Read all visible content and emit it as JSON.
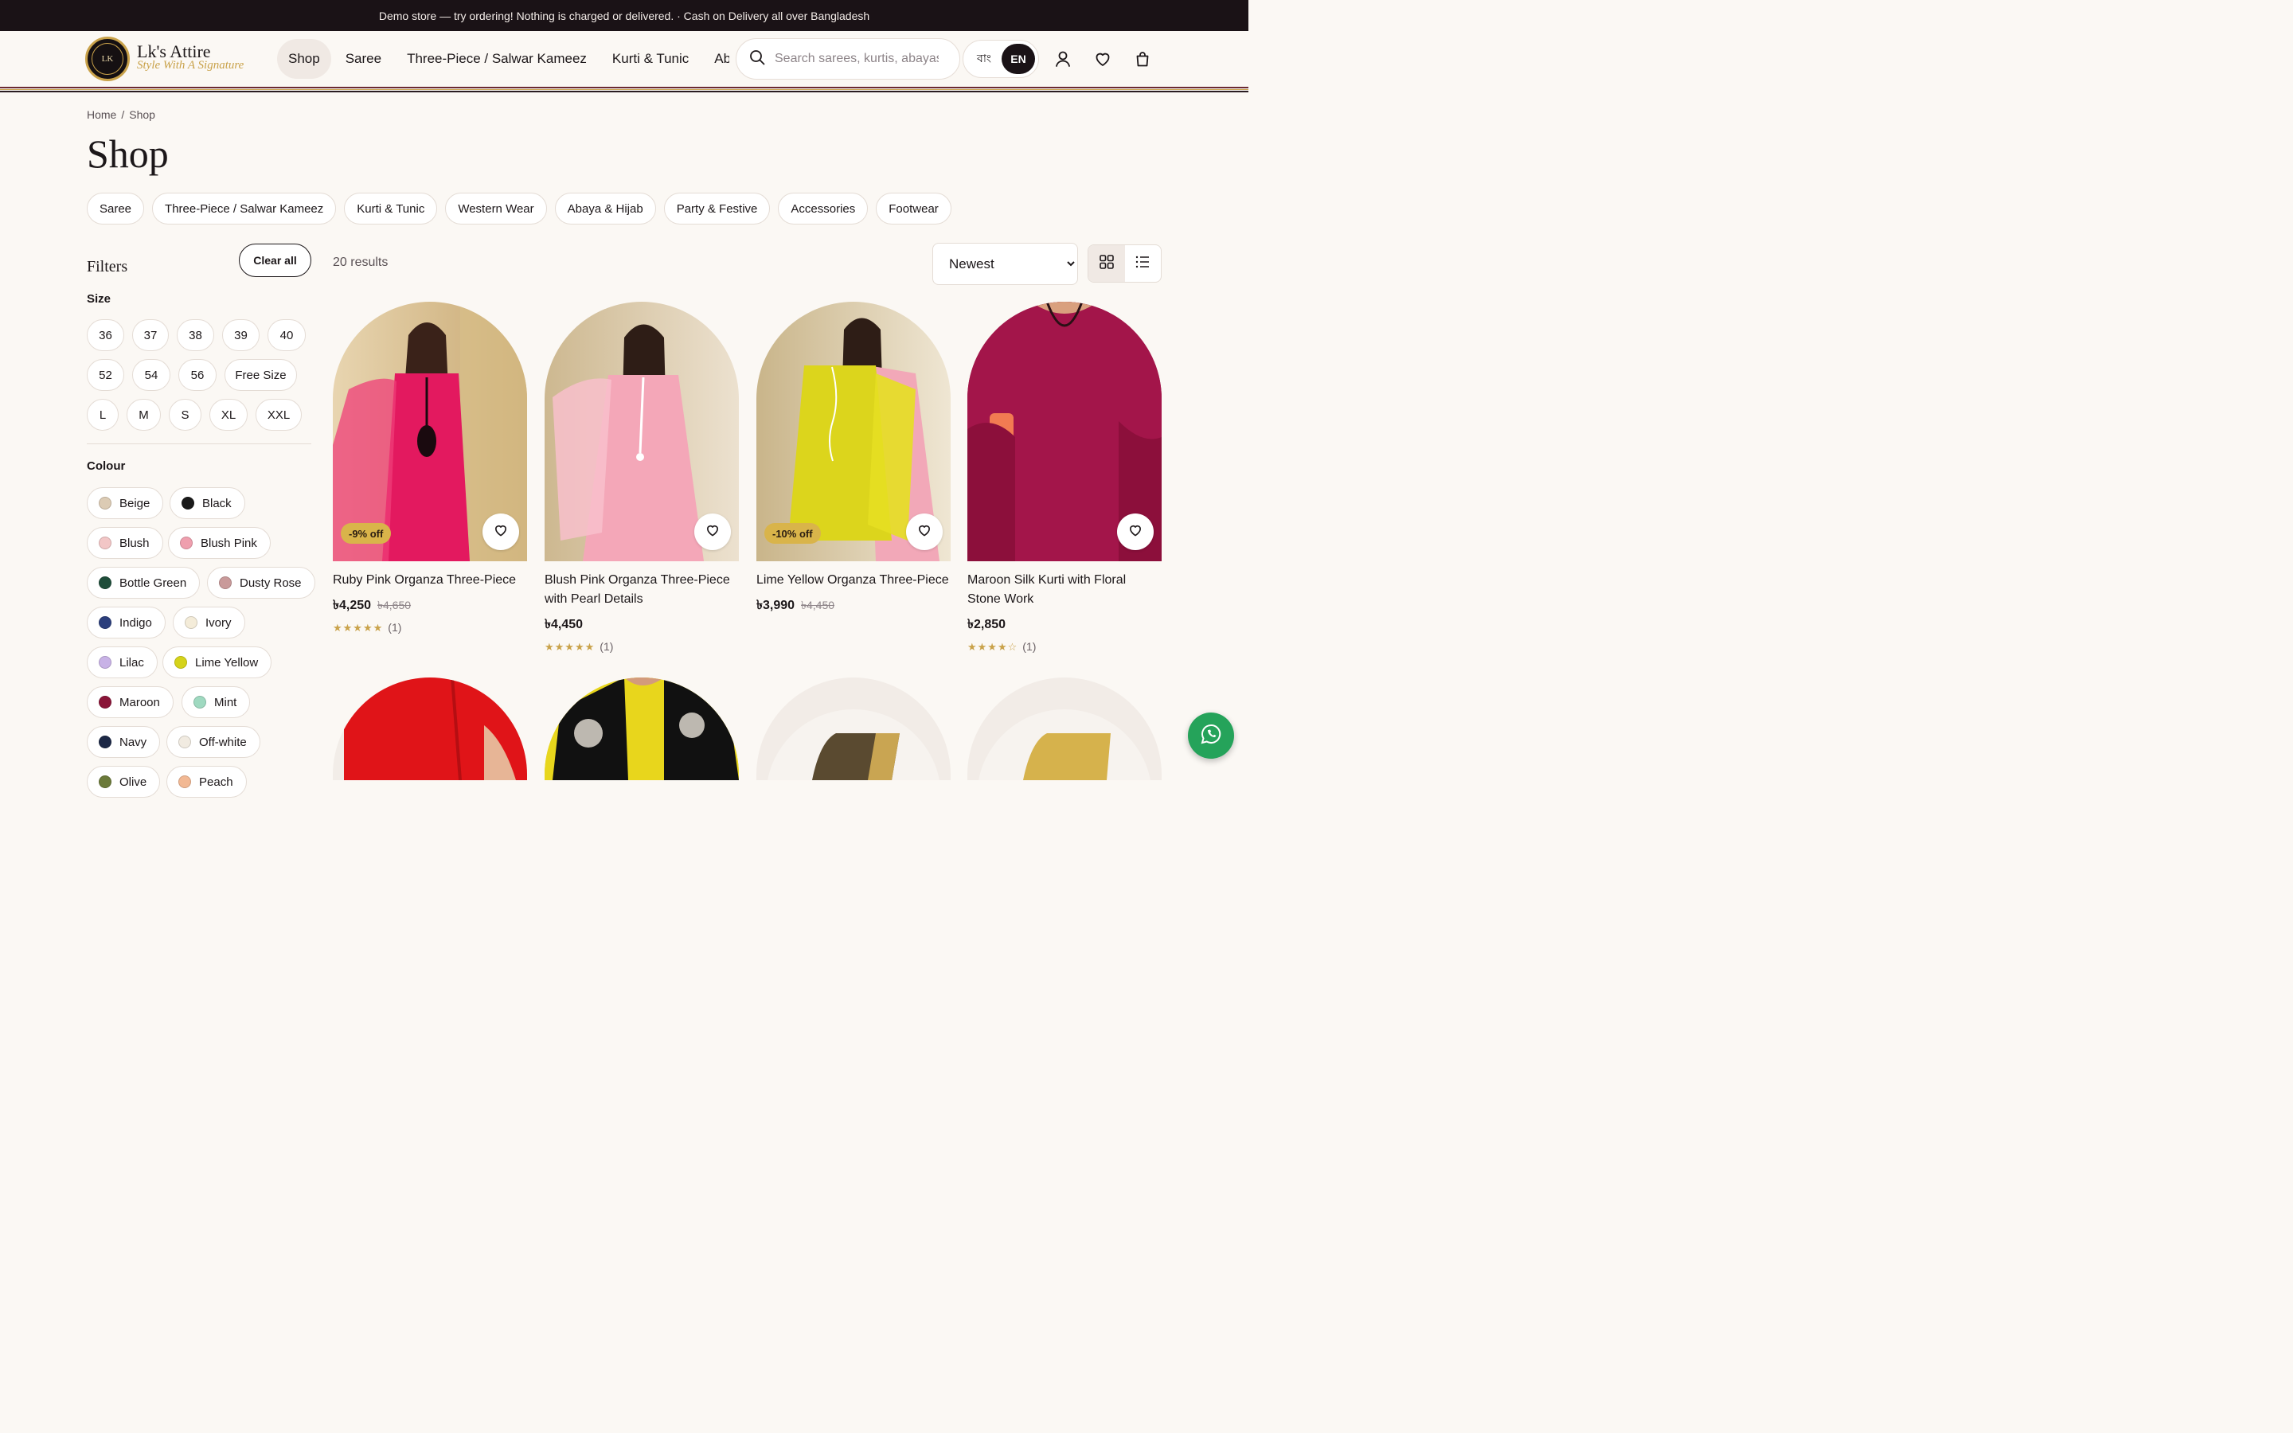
{
  "announcement": "Demo store — try ordering! Nothing is charged or delivered. · Cash on Delivery all over Bangladesh",
  "brand": {
    "name": "Lk's Attire",
    "tagline": "Style With A Signature",
    "logo_text": "LK"
  },
  "nav": [
    {
      "label": "Shop",
      "active": true
    },
    {
      "label": "Saree"
    },
    {
      "label": "Three-Piece / Salwar Kameez"
    },
    {
      "label": "Kurti & Tunic"
    },
    {
      "label": "Abou"
    }
  ],
  "search": {
    "placeholder": "Search sarees, kurtis, abayas…"
  },
  "lang": {
    "bn": "বাং",
    "en": "EN"
  },
  "breadcrumb": [
    "Home",
    "/",
    "Shop"
  ],
  "page_title": "Shop",
  "categories": [
    "Saree",
    "Three-Piece / Salwar Kameez",
    "Kurti & Tunic",
    "Western Wear",
    "Abaya & Hijab",
    "Party & Festive",
    "Accessories",
    "Footwear"
  ],
  "filters": {
    "title": "Filters",
    "clear_all": "Clear all",
    "size_title": "Size",
    "sizes": [
      "36",
      "37",
      "38",
      "39",
      "40",
      "52",
      "54",
      "56",
      "Free Size",
      "L",
      "M",
      "S",
      "XL",
      "XXL"
    ],
    "colour_title": "Colour",
    "colours": [
      {
        "name": "Beige",
        "hex": "#dccbb4"
      },
      {
        "name": "Black",
        "hex": "#1a1a1a"
      },
      {
        "name": "Blush",
        "hex": "#f2c6c6"
      },
      {
        "name": "Blush Pink",
        "hex": "#ef9fae"
      },
      {
        "name": "Bottle Green",
        "hex": "#1f4d3a"
      },
      {
        "name": "Dusty Rose",
        "hex": "#c99a9a"
      },
      {
        "name": "Indigo",
        "hex": "#2c3f7c"
      },
      {
        "name": "Ivory",
        "hex": "#f4ecd9"
      },
      {
        "name": "Lilac",
        "hex": "#c8b2e6"
      },
      {
        "name": "Lime Yellow",
        "hex": "#d5d31a"
      },
      {
        "name": "Maroon",
        "hex": "#8a1538"
      },
      {
        "name": "Mint",
        "hex": "#9fd9c0"
      },
      {
        "name": "Navy",
        "hex": "#1c2846"
      },
      {
        "name": "Off-white",
        "hex": "#f1ebe1"
      },
      {
        "name": "Olive",
        "hex": "#6b7a3a"
      },
      {
        "name": "Peach",
        "hex": "#f2b893"
      }
    ]
  },
  "results_count": "20 results",
  "sort": {
    "selected": "Newest"
  },
  "products": [
    {
      "name": "Ruby Pink Organza Three-Piece",
      "price": "৳4,250",
      "old_price": "৳4,650",
      "badge": "-9% off",
      "stars": "★★★★★",
      "rating": 5,
      "reviews": "(1)",
      "color": "#e01b63"
    },
    {
      "name": "Blush Pink Organza Three-Piece with Pearl Details",
      "price": "৳4,450",
      "old_price": "",
      "badge": "",
      "stars": "★★★★★",
      "rating": 5,
      "reviews": "(1)",
      "color": "#f2a5b5"
    },
    {
      "name": "Lime Yellow Organza Three-Piece",
      "price": "৳3,990",
      "old_price": "৳4,450",
      "badge": "-10% off",
      "stars": "",
      "rating": 0,
      "reviews": "",
      "color": "#d9d31e"
    },
    {
      "name": "Maroon Silk Kurti with Floral Stone Work",
      "price": "৳2,850",
      "old_price": "",
      "badge": "",
      "stars": "★★★★☆",
      "rating": 4,
      "reviews": "(1)",
      "color": "#a8154a"
    }
  ]
}
